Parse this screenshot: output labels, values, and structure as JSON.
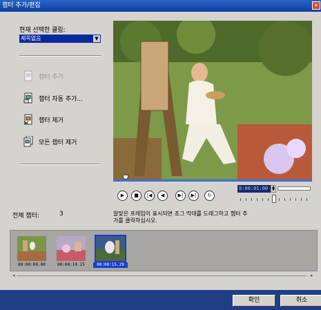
{
  "window": {
    "title": "챕터 추가/편집"
  },
  "sidebar": {
    "current_clip_label": "현재 선택한 클립:",
    "clip_select_value": "제목없음",
    "actions": {
      "add_chapter": "챕터 추가",
      "auto_add_chapter": "챕터 자동 추가...",
      "remove_chapter": "챕터 제거",
      "remove_all_chapters": "모든 챕터 제거"
    }
  },
  "player": {
    "timecode": "0:00:01:00",
    "hint": "알맞은 프레임이 표시되면 조그 막대를 드래그하고 챕터 추가를 클릭하십시오.",
    "scrub_position": 0.05,
    "jog_position": 0.55
  },
  "chapters": {
    "total_label": "전체 챕터:",
    "total_count": "3",
    "items": [
      {
        "timecode": "00:00:00.00",
        "selected": false
      },
      {
        "timecode": "00:00:10.15",
        "selected": false
      },
      {
        "timecode": "00:00:15.29",
        "selected": true
      }
    ]
  },
  "footer": {
    "ok_label": "확인",
    "cancel_label": "취소"
  },
  "colors": {
    "title_bar": "#0b3fa0",
    "selection": "#1a3dcc",
    "bottom_bar": "#1f3e86",
    "window_bg": "#d6d3ce"
  }
}
